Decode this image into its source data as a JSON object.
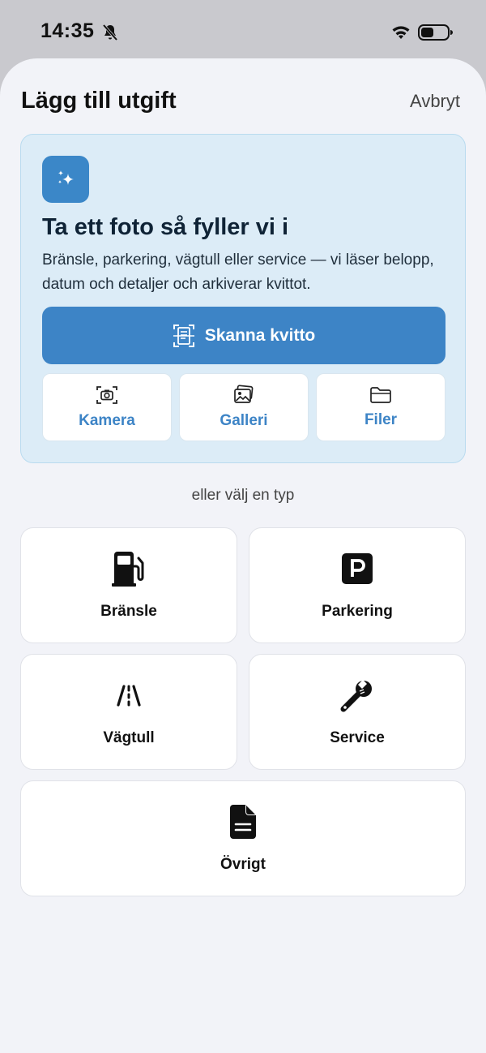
{
  "status_bar": {
    "time": "14:35"
  },
  "header": {
    "title": "Lägg till utgift",
    "cancel_label": "Avbryt"
  },
  "scan_card": {
    "title": "Ta ett foto så fyller vi i",
    "description": "Bränsle, parkering, vägtull eller service — vi läser belopp, datum och detaljer och arkiverar kvittot.",
    "scan_button_label": "Skanna kvitto",
    "sources": [
      {
        "label": "Kamera",
        "icon": "camera-viewfinder-icon"
      },
      {
        "label": "Galleri",
        "icon": "photo-stack-icon"
      },
      {
        "label": "Filer",
        "icon": "folder-icon"
      }
    ],
    "accent_color": "#3d84c6"
  },
  "divider_label": "eller välj en typ",
  "types": [
    {
      "label": "Bränsle",
      "icon": "fuel-pump-icon"
    },
    {
      "label": "Parkering",
      "icon": "parking-sign-icon"
    },
    {
      "label": "Vägtull",
      "icon": "road-lanes-icon"
    },
    {
      "label": "Service",
      "icon": "wrench-icon"
    },
    {
      "label": "Övrigt",
      "icon": "document-icon"
    }
  ]
}
